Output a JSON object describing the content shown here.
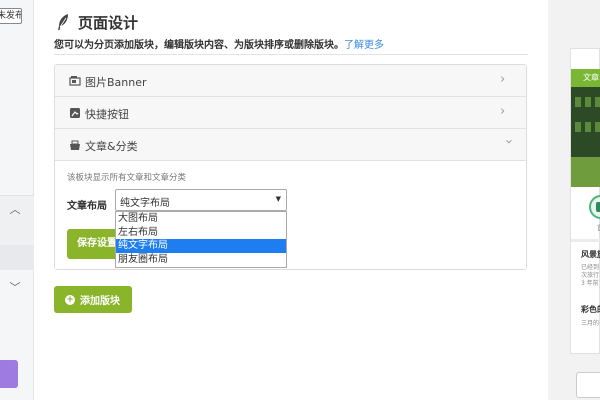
{
  "sidebar": {
    "publish_label": "未发布"
  },
  "page": {
    "title": "页面设计",
    "description": "您可以为分页添加版块，编辑版块内容、为版块排序或删除版块。",
    "learn_more": "了解更多"
  },
  "sections": [
    {
      "label": "图片Banner",
      "icon": "image-banner-icon",
      "expanded": false
    },
    {
      "label": "快捷按钮",
      "icon": "quick-button-icon",
      "expanded": false
    },
    {
      "label": "文章&分类",
      "icon": "article-category-icon",
      "expanded": true
    }
  ],
  "article_section": {
    "note": "该板块显示所有文章和文章分类",
    "layout_label": "文章布局",
    "selected_value": "纯文字布局",
    "options": [
      "大图布局",
      "左右布局",
      "纯文字布局",
      "朋友圈布局"
    ],
    "save_label": "保存设置"
  },
  "add_block_label": "添加版块",
  "preview": {
    "header_text": "文章",
    "item1_label": "首",
    "title1": "风景旅",
    "sub1": "已经到\n次旅行\n3 年前",
    "title2": "彩色的",
    "sub2": "三月的"
  },
  "colors": {
    "accent_green": "#8ab42a",
    "link_blue": "#3b8ad9",
    "selected_option": "#1e7ef0"
  }
}
